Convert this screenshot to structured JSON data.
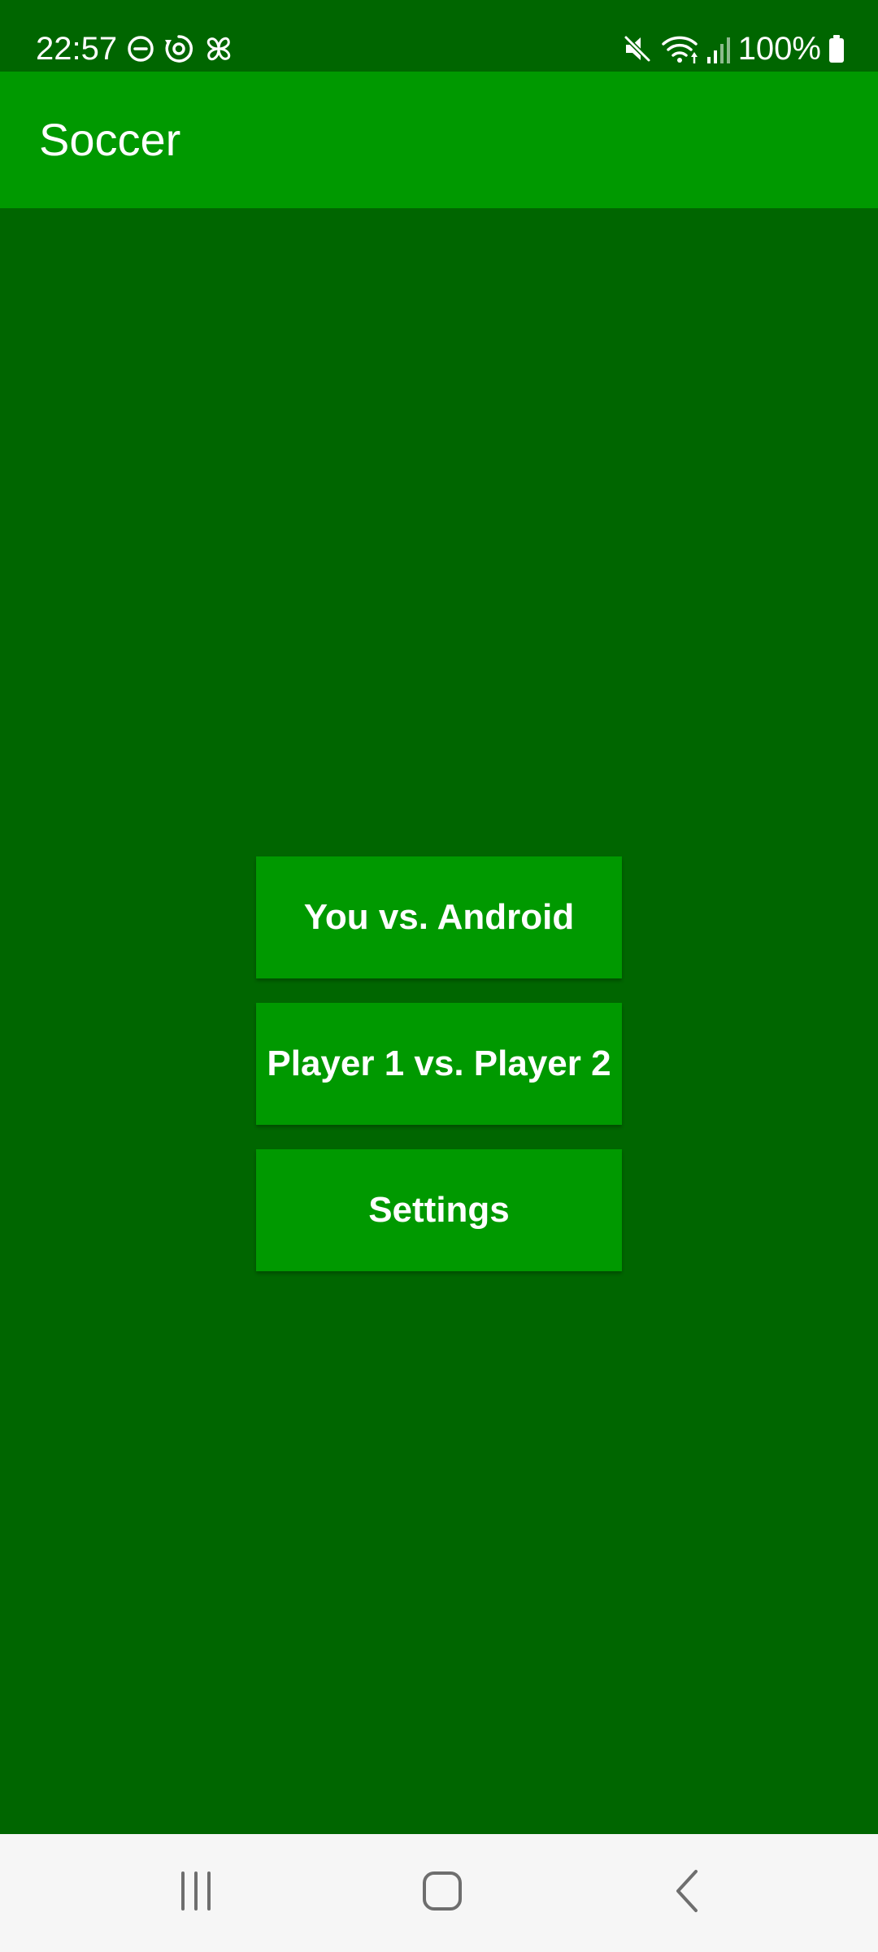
{
  "status_bar": {
    "time": "22:57",
    "battery_text": "100%",
    "left_icons": [
      "do-not-disturb-icon",
      "sync-icon",
      "pinwheel-icon"
    ],
    "right_icons": [
      "mute-icon",
      "wifi-icon",
      "signal-icon",
      "battery-icon"
    ]
  },
  "app_bar": {
    "title": "Soccer"
  },
  "menu": {
    "buttons": [
      {
        "label": "You vs. Android"
      },
      {
        "label": "Player 1 vs. Player 2"
      },
      {
        "label": "Settings"
      }
    ]
  },
  "nav_bar": {
    "icons": [
      "recents-icon",
      "home-icon",
      "back-icon"
    ]
  },
  "colors": {
    "background": "#006600",
    "app_bar": "#009900",
    "button": "#009900",
    "nav_bar": "#f6f6f6",
    "text": "#ffffff"
  }
}
